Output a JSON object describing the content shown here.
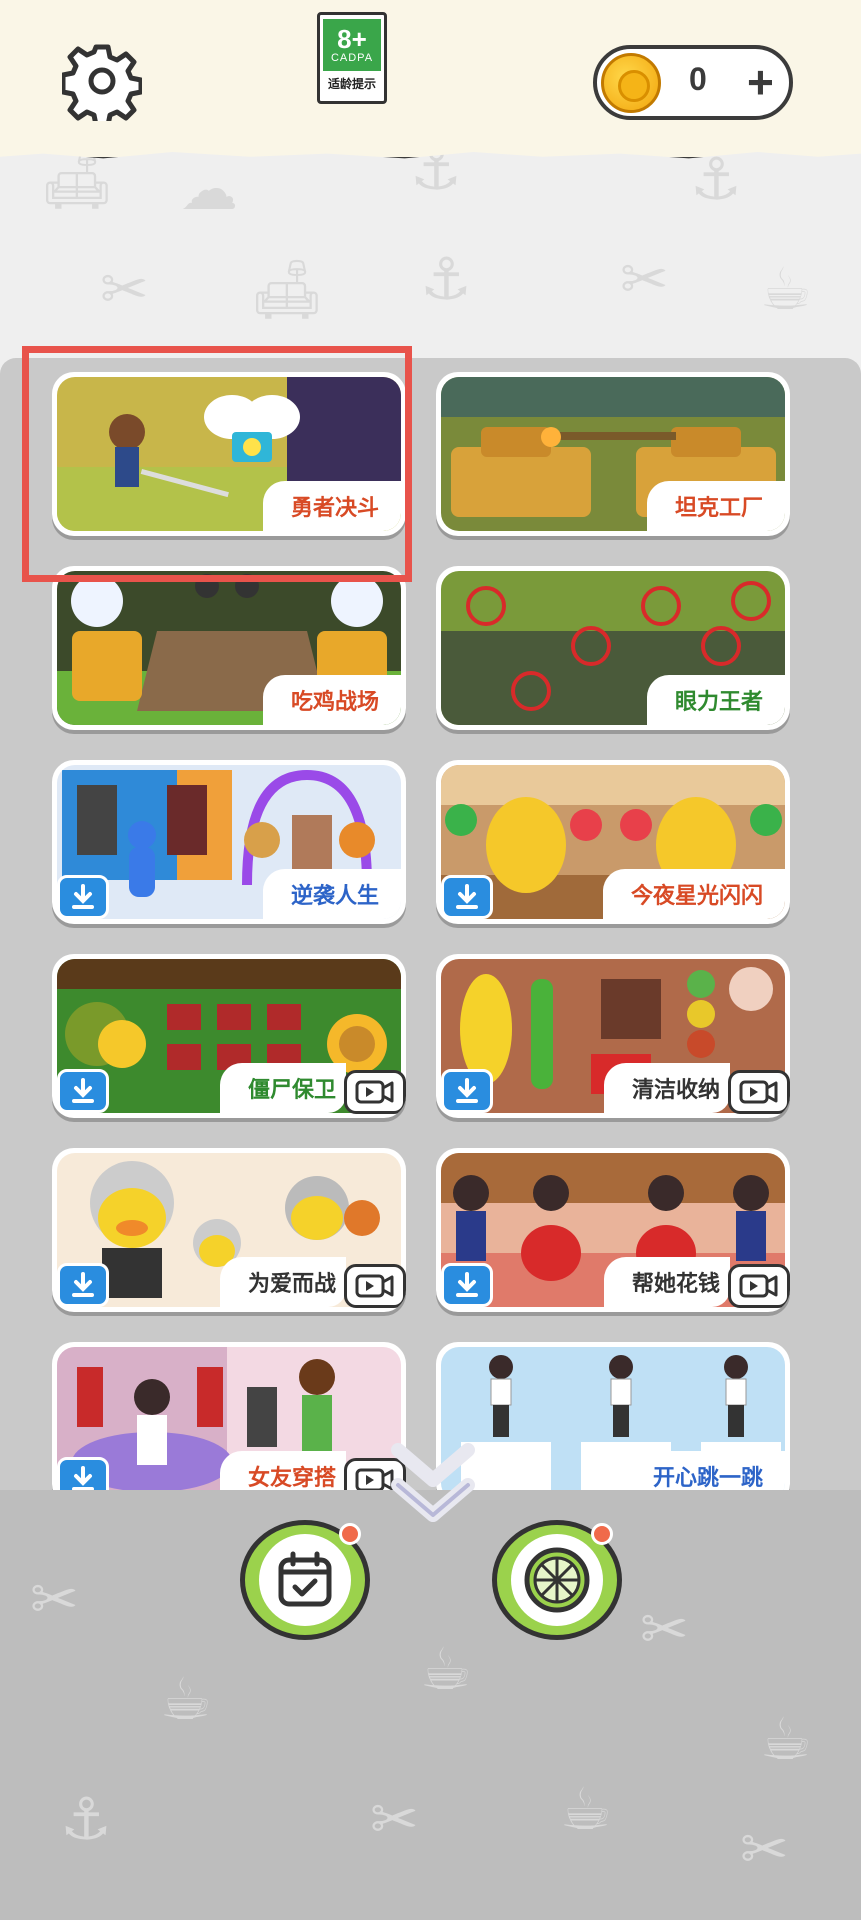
{
  "header": {
    "settings_icon": "gear-icon",
    "age_rating": {
      "age": "8+",
      "org": "CADPA",
      "tip": "适龄提示"
    },
    "coins": {
      "count": "0",
      "plus": "+"
    }
  },
  "games": [
    {
      "title": "勇者决斗",
      "color": "red",
      "download": false,
      "video": false,
      "bg": "#bfae3a"
    },
    {
      "title": "坦克工厂",
      "color": "red",
      "download": false,
      "video": false,
      "bg": "#a88a32"
    },
    {
      "title": "吃鸡战场",
      "color": "red",
      "download": false,
      "video": false,
      "bg": "#8a7a4a"
    },
    {
      "title": "眼力王者",
      "color": "green",
      "download": false,
      "video": false,
      "bg": "#7a9a3a"
    },
    {
      "title": "逆袭人生",
      "color": "blue",
      "download": true,
      "video": false,
      "bg": "#dfe9f6"
    },
    {
      "title": "今夜星光闪闪",
      "color": "red",
      "download": true,
      "video": false,
      "bg": "#c99a6a"
    },
    {
      "title": "僵尸保卫",
      "color": "green",
      "download": true,
      "video": true,
      "bg": "#3d8a2d"
    },
    {
      "title": "清洁收纳",
      "color": "gray",
      "download": true,
      "video": true,
      "bg": "#b06a4a"
    },
    {
      "title": "为爱而战",
      "color": "gray",
      "download": true,
      "video": true,
      "bg": "#f7ead9"
    },
    {
      "title": "帮她花钱",
      "color": "gray",
      "download": true,
      "video": true,
      "bg": "#e9b39a"
    },
    {
      "title": "女友穿搭",
      "color": "red",
      "download": true,
      "video": true,
      "bg": "#f3d9e3"
    },
    {
      "title": "开心跳一跳",
      "color": "blue",
      "download": false,
      "video": false,
      "bg": "#bfe0f5"
    }
  ],
  "bottom": {
    "calendar_icon": "calendar-check-icon",
    "lime_icon": "lime-slice-icon"
  },
  "colors": {
    "accent": "#9bd24c",
    "highlight": "#e8534b",
    "download": "#2a8ddf"
  }
}
